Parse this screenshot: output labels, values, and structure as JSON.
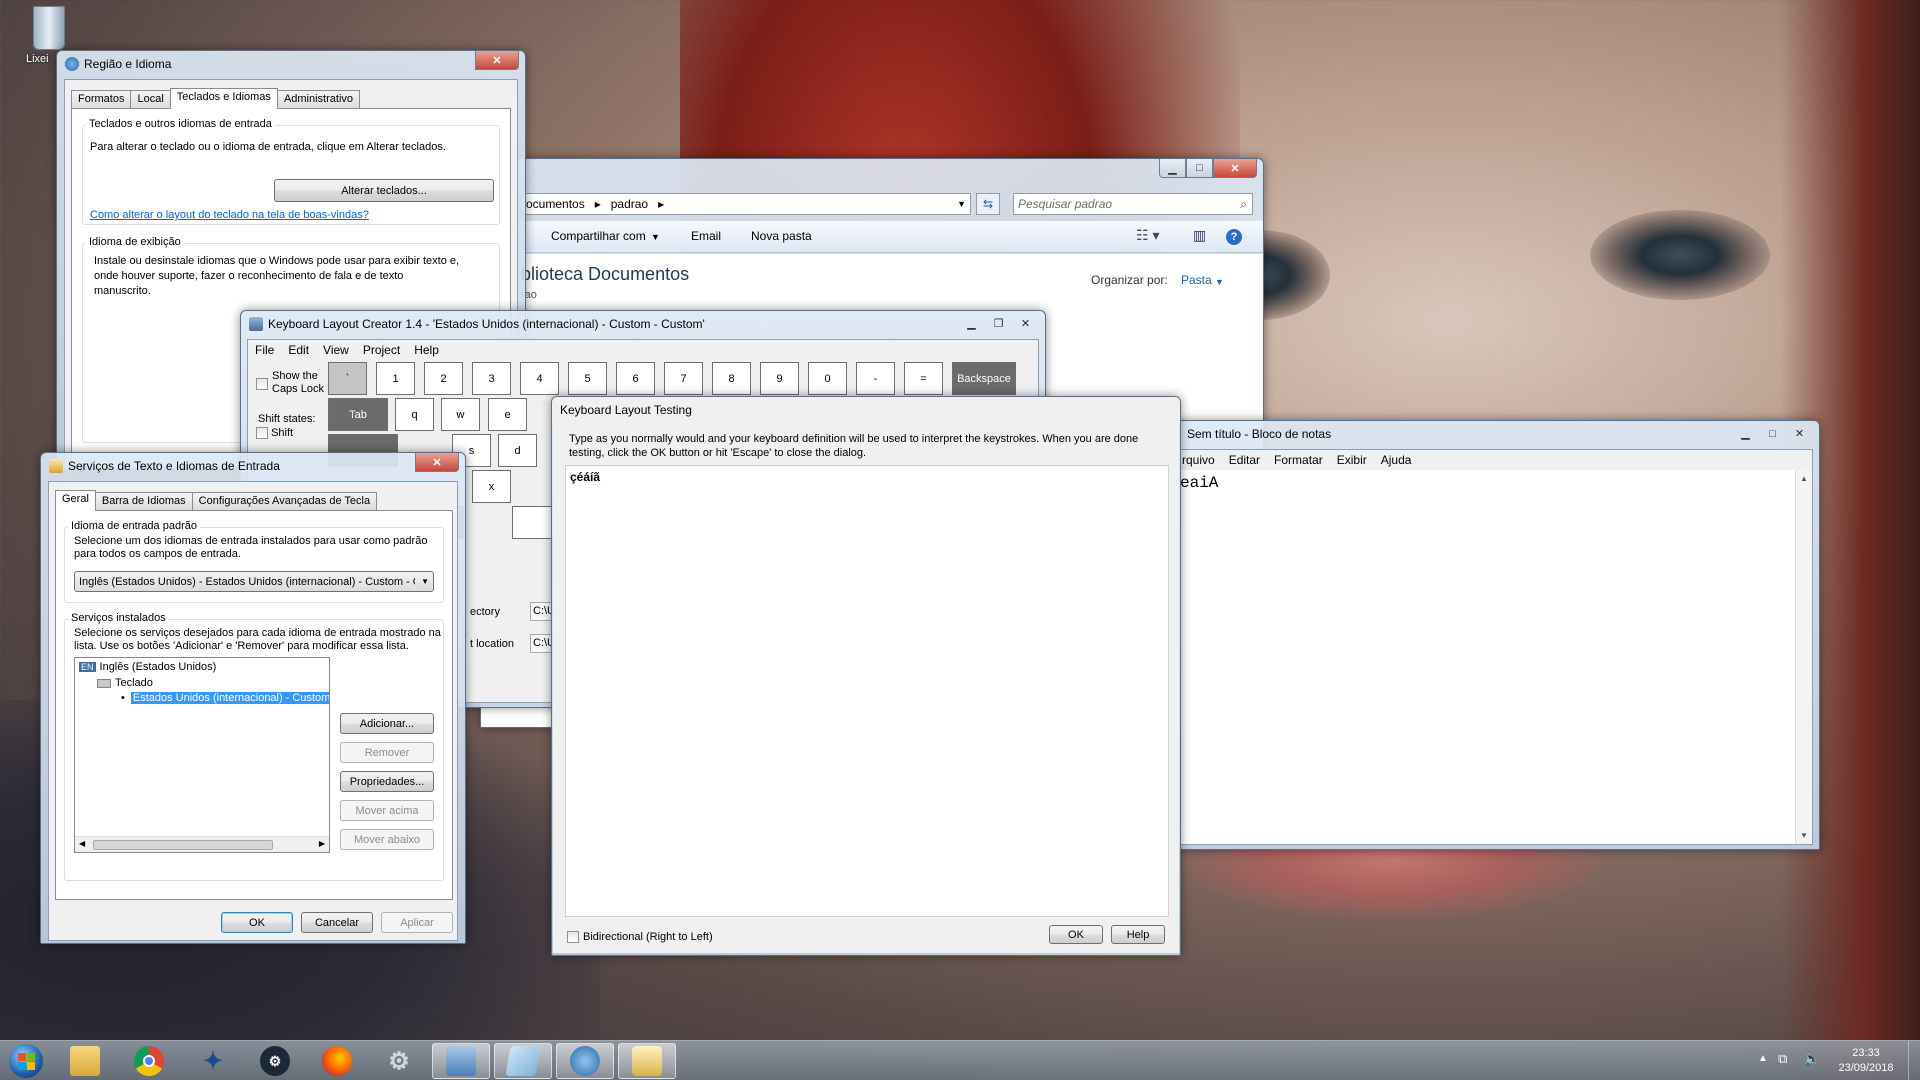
{
  "desktop": {
    "recycle_bin_label": "Lixei"
  },
  "regiao": {
    "title": "Região e Idioma",
    "tabs": [
      "Formatos",
      "Local",
      "Teclados e Idiomas",
      "Administrativo"
    ],
    "group1_label": "Teclados e outros idiomas de entrada",
    "group1_text": "Para alterar o teclado ou o idioma de entrada, clique em Alterar teclados.",
    "alterar_button": "Alterar teclados...",
    "link": "Como alterar o layout do teclado na tela de boas-vindas?",
    "group2_label": "Idioma de exibição",
    "group2_text": [
      "Instale ou desinstale idiomas que o Windows pode usar para exibir texto e,",
      "onde houver suporte, fazer o reconhecimento de fala e de texto",
      "manuscrito."
    ]
  },
  "explorer": {
    "address": [
      "ocumentos",
      "padrao"
    ],
    "search_placeholder": "Pesquisar padrao",
    "toolbar": [
      "Compartilhar com",
      "Email",
      "Nova pasta"
    ],
    "library_title": "blioteca Documentos",
    "library_sub": "rao",
    "organize_label": "Organizar por:",
    "organize_value": "Pasta"
  },
  "klc": {
    "title": "Keyboard Layout Creator 1.4 - 'Estados Unidos (internacional) - Custom - Custom'",
    "menu": [
      "File",
      "Edit",
      "View",
      "Project",
      "Help"
    ],
    "caps_label": [
      "Show the",
      "Caps Lock"
    ],
    "shift_states_label": "Shift states:",
    "shift_label": "Shift",
    "row1": [
      "`",
      "1",
      "2",
      "3",
      "4",
      "5",
      "6",
      "7",
      "8",
      "9",
      "0",
      "-",
      "=",
      "Backspace"
    ],
    "row2": [
      "Tab",
      "q",
      "w",
      "e"
    ],
    "row3": [
      "s",
      "d"
    ],
    "row4": [
      "x"
    ],
    "dir_label": "ectory",
    "dir_value": "C:\\U",
    "loc_label": "t location",
    "loc_value": "C:\\U"
  },
  "testing": {
    "title": "Keyboard Layout Testing",
    "instructions": [
      "Type as you normally would and your keyboard definition will be used to interpret the keystrokes. When you are done",
      "testing, click the OK button or hit 'Escape' to close the dialog."
    ],
    "typed_text": "çéáíã",
    "bidi_label": "Bidirectional (Right to Left)",
    "ok_button": "OK",
    "help_button": "Help"
  },
  "notepad": {
    "title": "Sem título - Bloco de notas",
    "menu": [
      "rquivo",
      "Editar",
      "Formatar",
      "Exibir",
      "Ajuda"
    ],
    "content": "eaiA"
  },
  "servicos": {
    "title": "Serviços de Texto e Idiomas de Entrada",
    "tabs": [
      "Geral",
      "Barra de Idiomas",
      "Configurações Avançadas de Tecla"
    ],
    "group1_label": "Idioma de entrada padrão",
    "group1_text": [
      "Selecione um dos idiomas de entrada instalados para usar como padrão",
      "para todos os campos de entrada."
    ],
    "dropdown_value": "Inglês (Estados Unidos) - Estados Unidos (internacional) - Custom - Cu:",
    "group2_label": "Serviços instalados",
    "group2_text": [
      "Selecione os serviços desejados para cada idioma de entrada mostrado na",
      "lista. Use os botões 'Adicionar' e 'Remover' para modificar essa lista."
    ],
    "tree": {
      "lang_badge": "EN",
      "lang": "Inglês (Estados Unidos)",
      "category": "Teclado",
      "item": "Estados Unidos (internacional) - Custom"
    },
    "side_buttons": [
      "Adicionar...",
      "Remover",
      "Propriedades...",
      "Mover acima",
      "Mover abaixo"
    ],
    "ok_button": "OK",
    "cancel_button": "Cancelar",
    "apply_button": "Aplicar"
  },
  "taskbar": {
    "apps": [
      "start",
      "explorer",
      "chrome",
      "battlenet",
      "steam",
      "firefox",
      "settings",
      "control-panel",
      "notepad",
      "keyboard-tool",
      "region"
    ],
    "time": "23:33",
    "date": "23/09/2018"
  }
}
